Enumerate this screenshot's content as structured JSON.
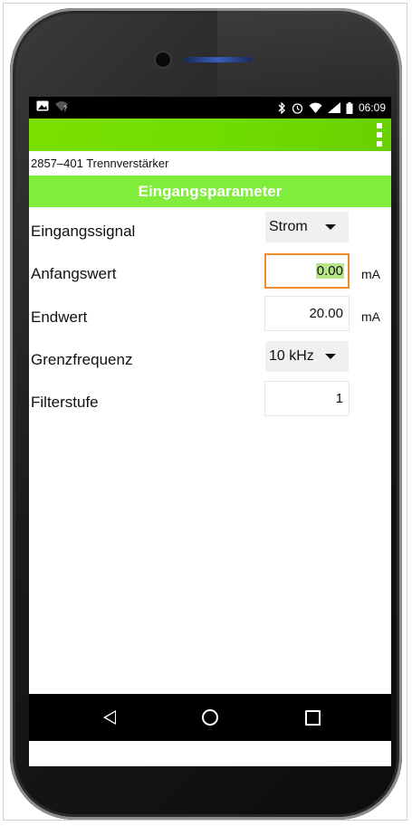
{
  "status_bar": {
    "time": "06:09",
    "left_icons": [
      "image-icon",
      "wifi-question-icon"
    ],
    "right_icons": [
      "bluetooth-icon",
      "alarm-icon",
      "wifi-icon",
      "signal-icon",
      "battery-icon"
    ]
  },
  "app_bar": {
    "menu_icon": "kebab-menu-icon",
    "color": "#6fdc00"
  },
  "device": {
    "title": "2857–401 Trennverstärker"
  },
  "section": {
    "title": "Eingangsparameter",
    "color": "#80ed3a"
  },
  "params": [
    {
      "label": "Eingangssignal",
      "type": "dropdown",
      "value": "Strom",
      "unit": ""
    },
    {
      "label": "Anfangswert",
      "type": "number",
      "value": "0.00",
      "unit": "mA",
      "focused": true
    },
    {
      "label": "Endwert",
      "type": "number",
      "value": "20.00",
      "unit": "mA"
    },
    {
      "label": "Grenzfrequenz",
      "type": "dropdown",
      "value": "10 kHz",
      "unit": ""
    },
    {
      "label": "Filterstufe",
      "type": "number",
      "value": "1",
      "unit": ""
    }
  ],
  "nav_bar": {
    "icons": [
      "back-icon",
      "home-icon",
      "recents-icon"
    ]
  },
  "colors": {
    "focus_border": "#f08c2a",
    "selection": "#b6e58a"
  }
}
